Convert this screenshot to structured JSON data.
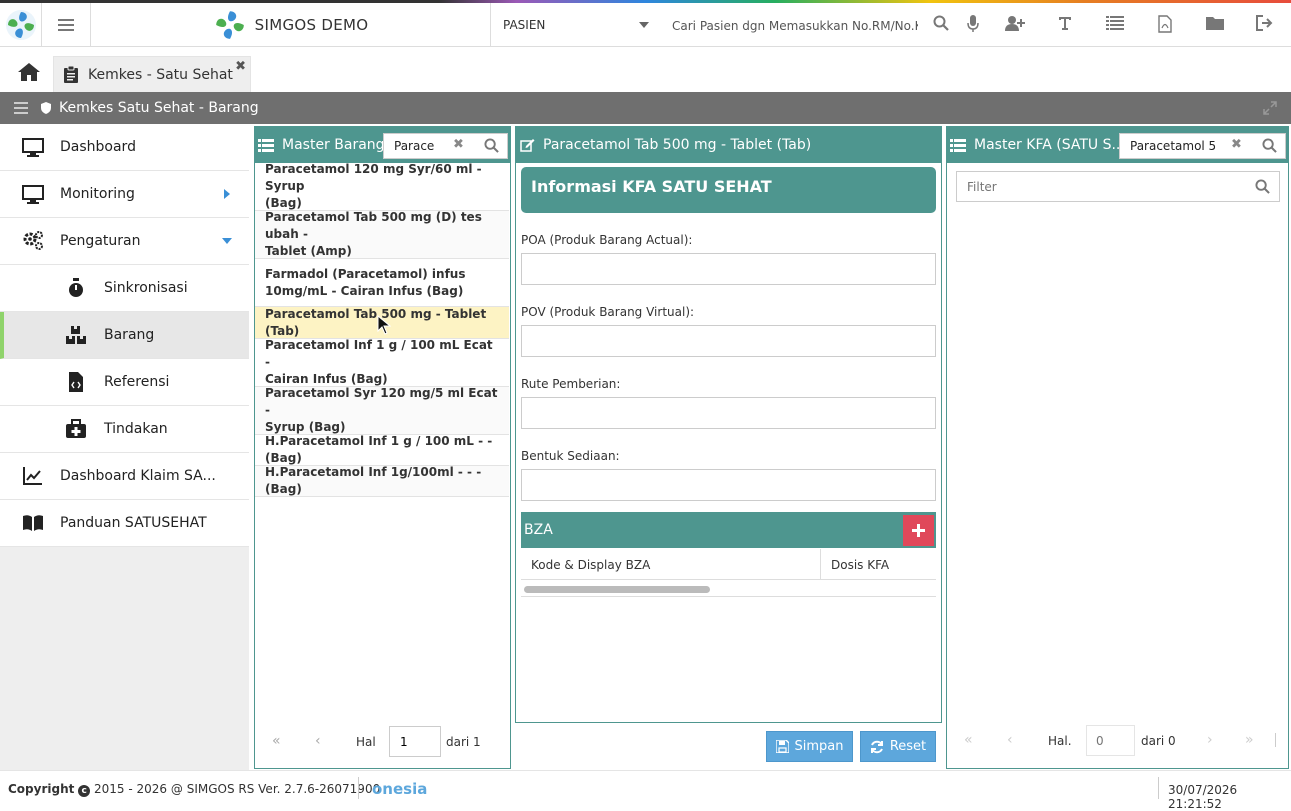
{
  "header": {
    "app_name": "SIMGOS DEMO",
    "pasien_select": "PASIEN",
    "search_placeholder": "Cari Pasien dgn Memasukkan No.RM/No.K"
  },
  "tabs": {
    "active_tab": "Kemkes - Satu Sehat"
  },
  "breadcrumb": {
    "text": "Kemkes Satu Sehat - Barang"
  },
  "sidebar": {
    "items": [
      {
        "label": "Dashboard",
        "icon": "monitor-icon"
      },
      {
        "label": "Monitoring",
        "icon": "monitor-icon"
      },
      {
        "label": "Pengaturan",
        "icon": "gears-icon"
      },
      {
        "label": "Sinkronisasi",
        "icon": "stopwatch-icon"
      },
      {
        "label": "Barang",
        "icon": "boxes-icon"
      },
      {
        "label": "Referensi",
        "icon": "file-code-icon"
      },
      {
        "label": "Tindakan",
        "icon": "medkit-icon"
      },
      {
        "label": "Dashboard Klaim SA...",
        "icon": "chart-line-icon"
      },
      {
        "label": "Panduan SATUSEHAT",
        "icon": "book-icon"
      }
    ]
  },
  "master_barang": {
    "title": "Master Barang",
    "search_value": "Parace",
    "items": [
      {
        "l1": "Paracetamol 120 mg Syr/60 ml - Syrup",
        "l2": "(Bag)"
      },
      {
        "l1": "Paracetamol Tab 500 mg (D) tes ubah -",
        "l2": "Tablet (Amp)"
      },
      {
        "l1": "Farmadol (Paracetamol) infus",
        "l2": "10mg/mL - Cairan Infus (Bag)"
      },
      {
        "l1": "Paracetamol Tab 500 mg - Tablet (Tab)",
        "l2": ""
      },
      {
        "l1": "Paracetamol Inf 1 g / 100 mL Ecat -",
        "l2": "Cairan Infus (Bag)"
      },
      {
        "l1": "Paracetamol Syr 120 mg/5 ml Ecat -",
        "l2": "Syrup (Bag)"
      },
      {
        "l1": "H.Paracetamol Inf 1 g / 100 mL - - (Bag)",
        "l2": ""
      },
      {
        "l1": "H.Paracetamol Inf 1g/100ml - - - (Bag)",
        "l2": ""
      }
    ],
    "pager": {
      "hal_label": "Hal",
      "page_value": "1",
      "of_label": "dari 1"
    }
  },
  "detail": {
    "title": "Paracetamol Tab 500 mg - Tablet (Tab)",
    "info_header": "Informasi KFA SATU SEHAT",
    "fields": [
      {
        "label": "POA (Produk Barang Actual):",
        "value": ""
      },
      {
        "label": "POV (Produk Barang Virtual):",
        "value": ""
      },
      {
        "label": "Rute Pemberian:",
        "value": ""
      },
      {
        "label": "Bentuk Sediaan:",
        "value": ""
      }
    ],
    "bza_title": "BZA",
    "bza_columns": [
      "Kode & Display BZA",
      "Dosis KFA"
    ],
    "save_label": "Simpan",
    "reset_label": "Reset"
  },
  "master_kfa": {
    "title": "Master KFA (SATU S...",
    "search_value": "Paracetamol 5",
    "filter_placeholder": "Filter",
    "pager": {
      "hal_label": "Hal.",
      "page_placeholder": "0",
      "of_label": "dari 0"
    }
  },
  "footer": {
    "copyright_bold": "Copyright",
    "copyright_rest": "2015 - 2026 @ SIMGOS RS Ver. 2.7.6-26071900",
    "partner": "onesia",
    "datetime": "30/07/2026 21:21:52"
  },
  "colors": {
    "teal": "#4e968f",
    "sidebar_accent": "#8fd36b",
    "selected_row": "#fdf3c4",
    "button_blue": "#5da7dc",
    "add_button_red": "#e0485a"
  }
}
